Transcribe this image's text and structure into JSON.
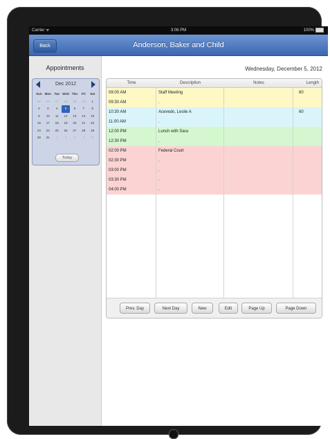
{
  "status_bar": {
    "carrier": "Carrier ᯤ",
    "time": "3:06 PM",
    "battery": "100%"
  },
  "nav": {
    "back_label": "Back",
    "title": "Anderson, Baker and Child"
  },
  "sidebar": {
    "title": "Appointments"
  },
  "calendar": {
    "month_label": "Dec  2012",
    "weekdays": [
      "Sun",
      "Mon",
      "Tue",
      "Wed",
      "Thu",
      "Fri",
      "Sat"
    ],
    "weeks": [
      [
        {
          "d": "25",
          "m": true
        },
        {
          "d": "26",
          "m": true
        },
        {
          "d": "27",
          "m": true
        },
        {
          "d": "28",
          "m": true
        },
        {
          "d": "29",
          "m": true
        },
        {
          "d": "30",
          "m": true
        },
        {
          "d": "1"
        }
      ],
      [
        {
          "d": "2"
        },
        {
          "d": "3"
        },
        {
          "d": "4"
        },
        {
          "d": "5",
          "sel": true
        },
        {
          "d": "6"
        },
        {
          "d": "7"
        },
        {
          "d": "8"
        }
      ],
      [
        {
          "d": "9"
        },
        {
          "d": "10"
        },
        {
          "d": "11"
        },
        {
          "d": "12"
        },
        {
          "d": "13"
        },
        {
          "d": "14"
        },
        {
          "d": "15"
        }
      ],
      [
        {
          "d": "16"
        },
        {
          "d": "17"
        },
        {
          "d": "18"
        },
        {
          "d": "19"
        },
        {
          "d": "20"
        },
        {
          "d": "21"
        },
        {
          "d": "22"
        }
      ],
      [
        {
          "d": "23"
        },
        {
          "d": "24"
        },
        {
          "d": "25"
        },
        {
          "d": "26"
        },
        {
          "d": "27"
        },
        {
          "d": "28"
        },
        {
          "d": "29"
        }
      ],
      [
        {
          "d": "30"
        },
        {
          "d": "31"
        },
        {
          "d": "1",
          "m": true
        },
        {
          "d": "2",
          "m": true
        },
        {
          "d": "3",
          "m": true
        },
        {
          "d": "4",
          "m": true
        },
        {
          "d": "5",
          "m": true
        }
      ]
    ],
    "today_label": "Today"
  },
  "main": {
    "date_label": "Wednesday, December 5, 2012"
  },
  "table": {
    "headers": {
      "time": "Time",
      "description": "Description",
      "notes": "Notes",
      "length": "Length"
    },
    "rows": [
      {
        "time": "09:00 AM",
        "description": "Staff Meeting",
        "notes": "",
        "length": "60",
        "color": "#fdf8c4"
      },
      {
        "time": "09:30 AM",
        "description": ".",
        "notes": "",
        "length": "",
        "color": "#fdf8c4"
      },
      {
        "time": "10:30 AM",
        "description": "Acevedo, Leslie A",
        "notes": "",
        "length": "60",
        "color": "#d9f5fb"
      },
      {
        "time": "11:00 AM",
        "description": ".",
        "notes": "",
        "length": "",
        "color": "#d9f5fb"
      },
      {
        "time": "12:00 PM",
        "description": "Lunch with Sara",
        "notes": "",
        "length": "",
        "color": "#d4f7cf"
      },
      {
        "time": "12:30 PM",
        "description": ".",
        "notes": "",
        "length": "",
        "color": "#d4f7cf"
      },
      {
        "time": "02:00 PM",
        "description": "Federal Court",
        "notes": "",
        "length": "",
        "color": "#fbd3d3"
      },
      {
        "time": "02:30 PM",
        "description": ".",
        "notes": "",
        "length": "",
        "color": "#fbd3d3"
      },
      {
        "time": "03:00 PM",
        "description": ".",
        "notes": "",
        "length": "",
        "color": "#fbd3d3"
      },
      {
        "time": "03:30 PM",
        "description": ".",
        "notes": "",
        "length": "",
        "color": "#fbd3d3"
      },
      {
        "time": "04:00 PM",
        "description": ".",
        "notes": "",
        "length": "",
        "color": "#fbd3d3"
      },
      {
        "time": "",
        "description": "",
        "notes": "",
        "length": "",
        "color": "#ffffff"
      },
      {
        "time": "",
        "description": "",
        "notes": "",
        "length": "",
        "color": "#ffffff"
      },
      {
        "time": "",
        "description": "",
        "notes": "",
        "length": "",
        "color": "#ffffff"
      },
      {
        "time": "",
        "description": "",
        "notes": "",
        "length": "",
        "color": "#ffffff"
      },
      {
        "time": "",
        "description": "",
        "notes": "",
        "length": "",
        "color": "#ffffff"
      },
      {
        "time": "",
        "description": "",
        "notes": "",
        "length": "",
        "color": "#ffffff"
      },
      {
        "time": "",
        "description": "",
        "notes": "",
        "length": "",
        "color": "#ffffff"
      },
      {
        "time": "",
        "description": "",
        "notes": "",
        "length": "",
        "color": "#ffffff"
      },
      {
        "time": "",
        "description": "",
        "notes": "",
        "length": "",
        "color": "#ffffff"
      },
      {
        "time": "",
        "description": "",
        "notes": "",
        "length": "",
        "color": "#ffffff"
      },
      {
        "time": "",
        "description": "",
        "notes": "",
        "length": "",
        "color": "#ffffff"
      }
    ]
  },
  "buttons": {
    "prev_day": "Prev. Day",
    "next_day": "Next Day",
    "new": "New",
    "edit": "Edit",
    "page_up": "Page Up",
    "page_down": "Page Down"
  }
}
